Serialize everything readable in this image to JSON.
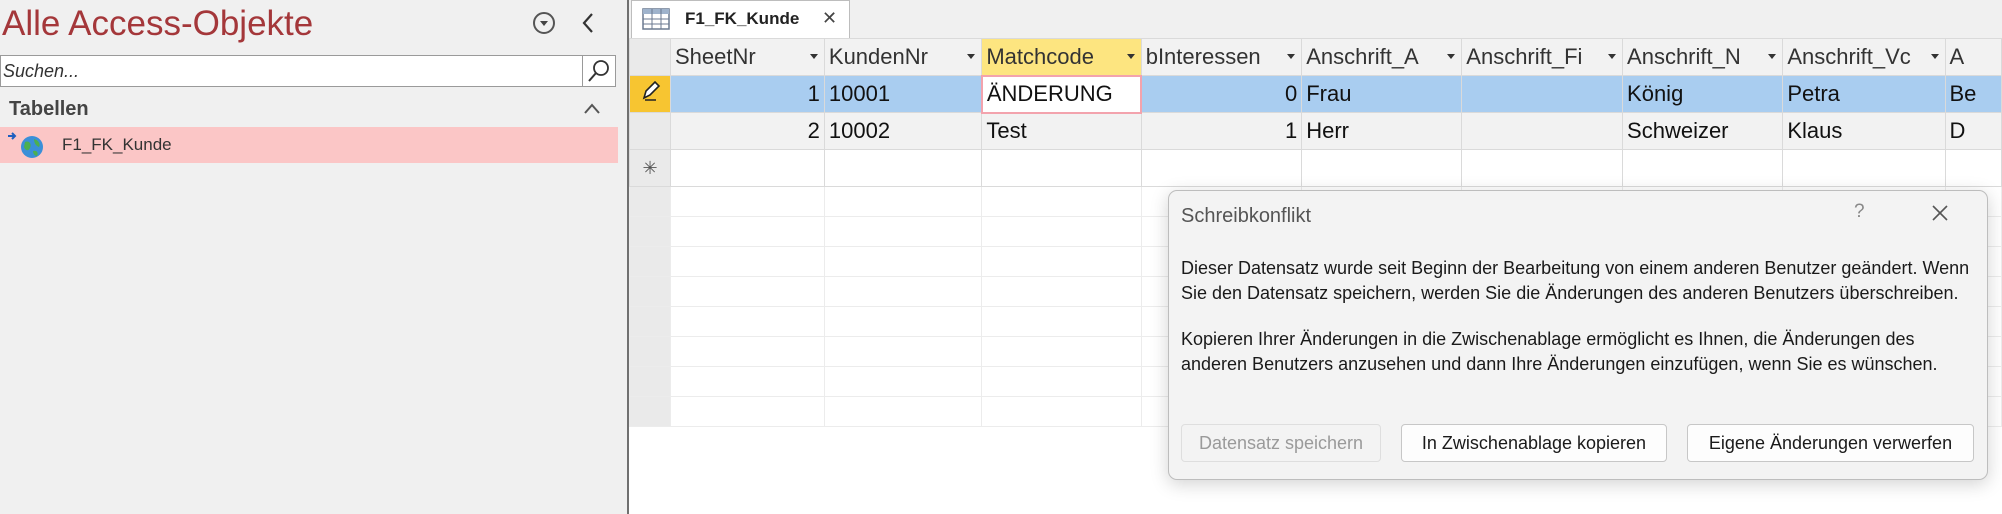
{
  "nav": {
    "title": "Alle Access-Objekte",
    "search_placeholder": "Suchen...",
    "group_label": "Tabellen",
    "items": [
      {
        "label": "F1_FK_Kunde",
        "icon": "linked-table-globe-icon"
      }
    ]
  },
  "document": {
    "tab_label": "F1_FK_Kunde",
    "columns": [
      "SheetNr",
      "KundenNr",
      "Matchcode",
      "bInteressen",
      "Anschrift_A",
      "Anschrift_Fi",
      "Anschrift_N",
      "Anschrift_Vc",
      "A"
    ],
    "rows": [
      [
        "1",
        "10001",
        "ÄNDERUNG",
        "0",
        "Frau",
        "",
        "König",
        "Petra",
        "Be"
      ],
      [
        "2",
        "10002",
        "Test",
        "1",
        "Herr",
        "",
        "Schweizer",
        "Klaus",
        "D"
      ]
    ],
    "new_row_marker": "✳"
  },
  "dialog": {
    "title": "Schreibkonflikt",
    "help": "?",
    "message1": "Dieser Datensatz wurde seit Beginn der Bearbeitung von einem anderen Benutzer geändert. Wenn Sie den Datensatz speichern, werden Sie die Änderungen des anderen Benutzers überschreiben.",
    "message2": "Kopieren Ihrer Änderungen in die Zwischenablage ermöglicht es Ihnen, die Änderungen des anderen Benutzers anzusehen und dann Ihre Änderungen einzufügen, wenn Sie es wünschen.",
    "buttons": {
      "save": "Datensatz speichern",
      "copy": "In Zwischenablage kopieren",
      "discard": "Eigene Änderungen verwerfen"
    }
  },
  "colors": {
    "title_accent": "#a4373a",
    "nav_selected": "#fbc6c6",
    "row_highlight": "#a9cdf0",
    "selected_header": "#fde580",
    "edit_indicator": "#f7c531"
  }
}
